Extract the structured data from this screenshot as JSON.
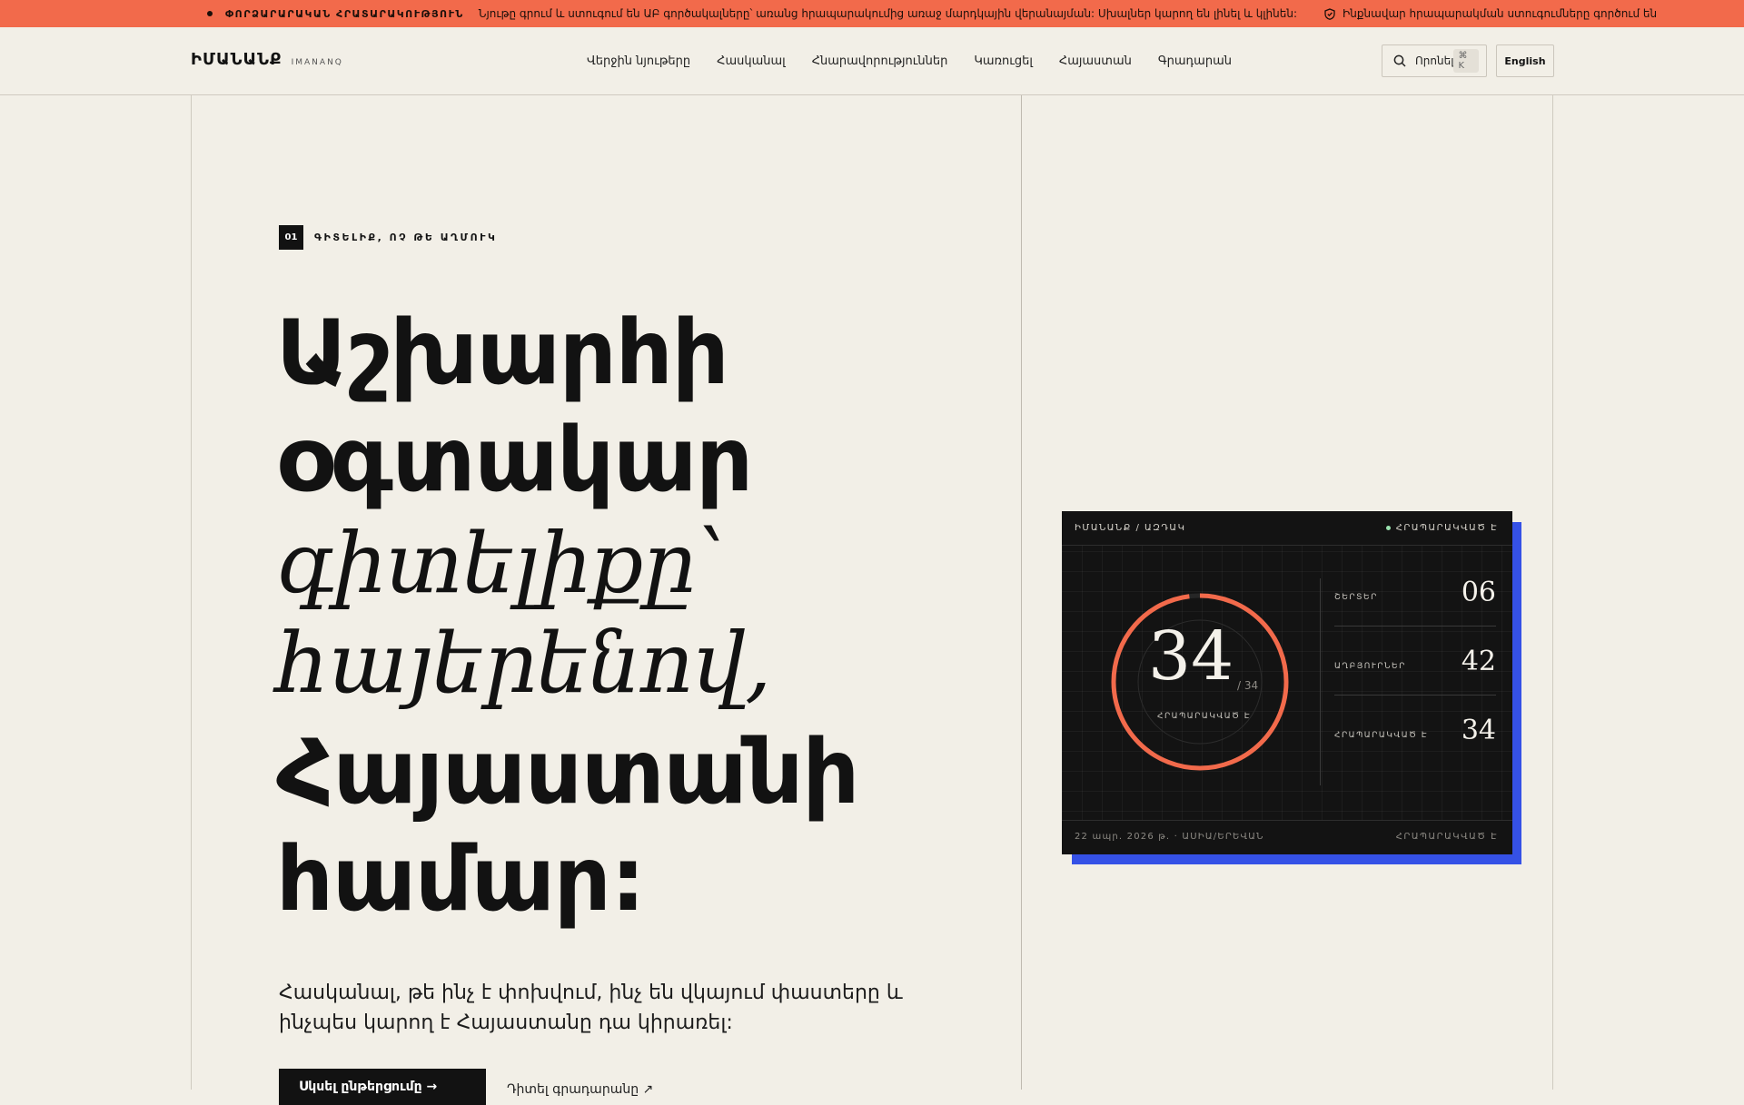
{
  "banner": {
    "tag": "ՓՈՐՁԱՐԱՐԱԿԱՆ ՀՐԱՏԱՐԱԿՈՒԹՅՈՒՆ",
    "message": "Նյութը գրում և ստուգում են ԱԲ գործակալները՝ առանց հրապարակումից առաջ մարդկային վերանայման: Սխալներ կարող են լինել և կլինեն:",
    "secondary": "Ինքնավար հրապարակման ստուգումները գործում են",
    "color": "#f26a4b"
  },
  "header": {
    "logo": "ԻՄԱՆԱՆՔ",
    "logo_sub": "IMANANQ",
    "nav": [
      "Վերջին նյութերը",
      "Հասկանալ",
      "Հնարավորություններ",
      "Կառուցել",
      "Հայաստան",
      "Գրադարան"
    ],
    "search_label": "Որոնել",
    "search_shortcut": "⌘ K",
    "language": "English"
  },
  "hero": {
    "eyebrow_num": "01",
    "eyebrow_label": "ԳԻՏԵԼԻՔ, ՈՉ ԹԵ ԱՂՄՈՒԿ",
    "headline": {
      "line1": "Աշխարհի",
      "line2": "օգտակար",
      "line3": "գիտելիքը՝",
      "line4": "հայերենով,",
      "line5": "Հայաստանի",
      "line6": "համար:"
    },
    "lead": "Հասկանալ, թե ինչ է փոխվում, ինչ են վկայում փաստերը և ինչպես կարող է Հայաստանը դա կիրառել:",
    "cta_primary": "Սկսել ընթերցումը →",
    "cta_secondary": "Դիտել գրադարանը ↗"
  },
  "card": {
    "brand": "ԻՄԱՆԱՆՔ / ԱԶԴԱԿ",
    "status": "ՀՐԱՊԱՐԱԿՎԱԾ Է",
    "published": 34,
    "total": "/ 34",
    "ring_label": "ՀՐԱՊԱՐԱԿՎԱԾ Է",
    "ring_fraction": 0.98,
    "stats": [
      {
        "label": "ՇԵՐՏԵՐ",
        "value": "06"
      },
      {
        "label": "ԱՂԲՅՈՒՐՆԵՐ",
        "value": "42"
      },
      {
        "label": "ՀՐԱՊԱՐԱԿՎԱԾ Է",
        "value": "34"
      }
    ],
    "footer_date": "22 ապր. 2026 թ. · ԱՍԻԱ/ԵՐԵՎԱՆ",
    "footer_status": "ՀՐԱՊԱՐԱԿՎԱԾ Է",
    "accent": "#f26a4b",
    "shadow_color": "#3551e6"
  }
}
